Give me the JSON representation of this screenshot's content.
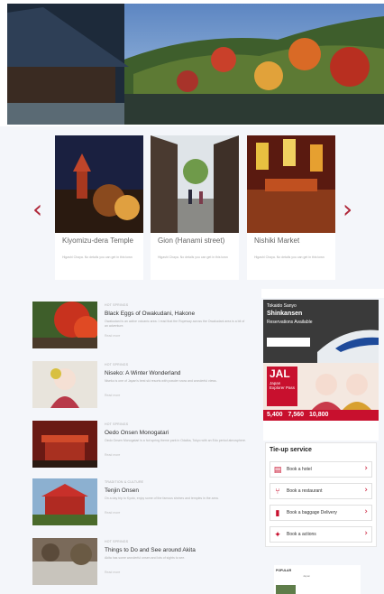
{
  "hero": {
    "image": "hero-image-kyoto-temple-autumn"
  },
  "carousel": {
    "prev_icon": "‹",
    "next_icon": "›",
    "cards": [
      {
        "title": "Kiyomizu-dera Temple",
        "desc": "Higashi Chaya. No details you can get in this town"
      },
      {
        "title": "Gion (Hanami street)",
        "desc": "Higashi Chaya. No details you can get in this town"
      },
      {
        "title": "Nishiki Market",
        "desc": "Higashi Chaya. No details you can get in this town"
      }
    ]
  },
  "articles": [
    {
      "category": "HOT SPRINGS",
      "title": "Black Eggs of Owakudani, Hakone",
      "desc": "Owakudani is an active volcanic area. I read that the Ropeway across the Owakudani area is a bit of an adventure.",
      "read": "Read more"
    },
    {
      "category": "HOT SPRINGS",
      "title": "Niseko: A Winter Wonderland",
      "desc": "Niseko is one of Japan's best ski resorts with powder snow and wonderful views.",
      "read": "Read more"
    },
    {
      "category": "HOT SPRINGS",
      "title": "Oedo Onsen Monogatari",
      "desc": "Oedo Onsen Monogatari is a hot spring theme park in Odaiba, Tokyo with an Edo period atmosphere.",
      "read": "Read more"
    },
    {
      "category": "TRADITION & CULTURE",
      "title": "Tenjin Onsen",
      "desc": "On a day trip to Kyoto, enjoy some of the famous shrines and temples in the area.",
      "read": "Read more"
    },
    {
      "category": "HOT SPRINGS",
      "title": "Things to Do and See around Akita",
      "desc": "Akita has some wonderful onsen and lots of sights to see.",
      "read": "Read more"
    }
  ],
  "sidebar": {
    "ad1": {
      "line1": "Tokaido Sanyo",
      "line2": "Shinkansen",
      "line3": "Reservations Available"
    },
    "ad2": {
      "brand": "JAL",
      "sub": "Japan Explorer Pass",
      "prices": [
        "5,400",
        "7,560",
        "10,800"
      ]
    },
    "tieup": {
      "heading": "Tie-up service",
      "items": [
        {
          "icon": "hotel-icon",
          "glyph": "▤",
          "label": "Book a hotel"
        },
        {
          "icon": "restaurant-icon",
          "glyph": "⑂",
          "label": "Book a restaurant"
        },
        {
          "icon": "luggage-icon",
          "glyph": "▮",
          "label": "Book a baggage Delivery"
        },
        {
          "icon": "activity-icon",
          "glyph": "✦",
          "label": "Book a actions"
        }
      ],
      "chevron": "›"
    },
    "popular": {
      "heading": "POPULAR",
      "tab": "Japan"
    }
  },
  "colors": {
    "accent": "#c8102e",
    "panel_bg": "#f4f6fa"
  }
}
